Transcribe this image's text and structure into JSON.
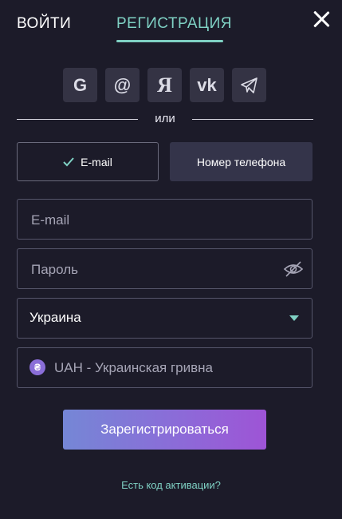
{
  "tabs": {
    "login": "ВОЙТИ",
    "register": "РЕГИСТРАЦИЯ",
    "active": "register"
  },
  "social": {
    "items": [
      {
        "name": "google",
        "icon": "google-icon",
        "glyph": "G"
      },
      {
        "name": "mail",
        "icon": "at-sign-icon",
        "glyph": "@"
      },
      {
        "name": "yandex",
        "icon": "yandex-icon",
        "glyph": "Я"
      },
      {
        "name": "vk",
        "icon": "vk-icon",
        "glyph": "vk"
      },
      {
        "name": "telegram",
        "icon": "telegram-icon",
        "glyph": ""
      }
    ]
  },
  "divider": {
    "text": "или"
  },
  "mode": {
    "email": "E-mail",
    "phone": "Номер телефона",
    "selected": "email"
  },
  "form": {
    "email_placeholder": "E-mail",
    "password_placeholder": "Пароль",
    "country": "Украина",
    "currency": "UAH - Украинская гривна",
    "currency_symbol": "₴"
  },
  "submit": {
    "label": "Зарегистрироваться"
  },
  "activation": {
    "label": "Есть код активации?"
  },
  "colors": {
    "background": "#1c1b29",
    "accent": "#7fd1c4",
    "button_gradient": [
      "#7587d6",
      "#9e54d6"
    ]
  }
}
